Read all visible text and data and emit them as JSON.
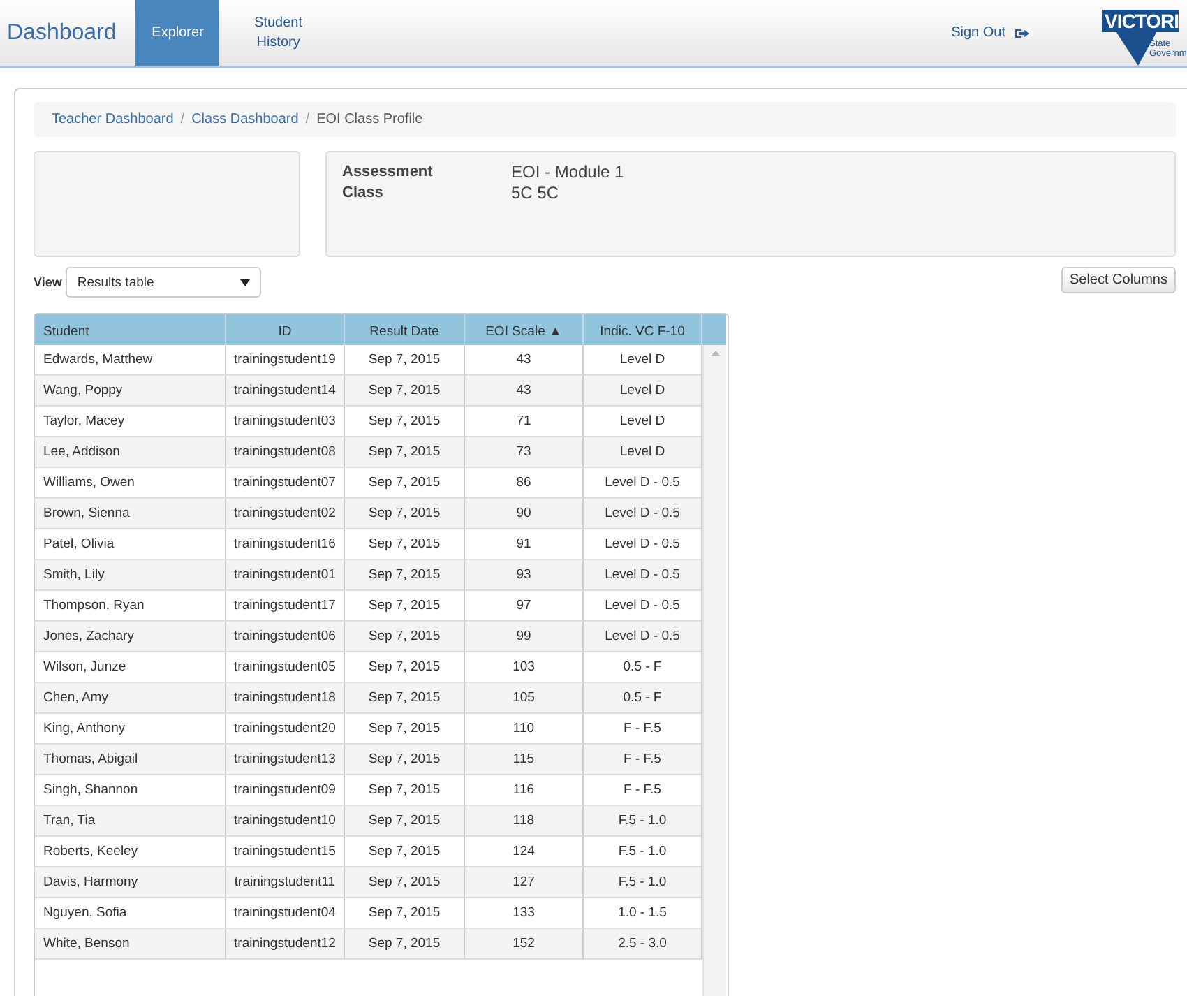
{
  "navbar": {
    "brand": "Dashboard",
    "tabs": [
      {
        "label": "Explorer",
        "selected": true
      },
      {
        "label": "Student History",
        "selected": false
      }
    ],
    "sign_out": "Sign Out",
    "logo": {
      "title": "VICTORI",
      "line_1": "State",
      "line_2": "Governm"
    }
  },
  "breadcrumb": [
    {
      "label": "Teacher Dashboard",
      "link": true
    },
    {
      "separator": "/",
      "label": "Class Dashboard",
      "link": true
    },
    {
      "separator": "/",
      "label": "EOI Class Profile",
      "link": false
    }
  ],
  "info": [
    {
      "label": "Assessment",
      "value": "EOI - Module 1"
    },
    {
      "label": "Class",
      "value": "5C 5C"
    }
  ],
  "view": {
    "label": "View",
    "value": "Results table"
  },
  "select_columns": "Select Columns",
  "table": {
    "columns": [
      "Student",
      "ID",
      "Result Date",
      "EOI Scale ▲",
      "Indic. VC F-10"
    ],
    "rows": [
      [
        "Edwards, Matthew",
        "trainingstudent19",
        "Sep 7, 2015",
        "43",
        "Level D"
      ],
      [
        "Wang, Poppy",
        "trainingstudent14",
        "Sep 7, 2015",
        "43",
        "Level D"
      ],
      [
        "Taylor, Macey",
        "trainingstudent03",
        "Sep 7, 2015",
        "71",
        "Level D"
      ],
      [
        "Lee, Addison",
        "trainingstudent08",
        "Sep 7, 2015",
        "73",
        "Level D"
      ],
      [
        "Williams, Owen",
        "trainingstudent07",
        "Sep 7, 2015",
        "86",
        "Level D - 0.5"
      ],
      [
        "Brown, Sienna",
        "trainingstudent02",
        "Sep 7, 2015",
        "90",
        "Level D - 0.5"
      ],
      [
        "Patel, Olivia",
        "trainingstudent16",
        "Sep 7, 2015",
        "91",
        "Level D - 0.5"
      ],
      [
        "Smith, Lily",
        "trainingstudent01",
        "Sep 7, 2015",
        "93",
        "Level D - 0.5"
      ],
      [
        "Thompson, Ryan",
        "trainingstudent17",
        "Sep 7, 2015",
        "97",
        "Level D - 0.5"
      ],
      [
        "Jones, Zachary",
        "trainingstudent06",
        "Sep 7, 2015",
        "99",
        "Level D - 0.5"
      ],
      [
        "Wilson, Junze",
        "trainingstudent05",
        "Sep 7, 2015",
        "103",
        "0.5 - F"
      ],
      [
        "Chen, Amy",
        "trainingstudent18",
        "Sep 7, 2015",
        "105",
        "0.5 - F"
      ],
      [
        "King, Anthony",
        "trainingstudent20",
        "Sep 7, 2015",
        "110",
        "F - F.5"
      ],
      [
        "Thomas, Abigail",
        "trainingstudent13",
        "Sep 7, 2015",
        "115",
        "F - F.5"
      ],
      [
        "Singh, Shannon",
        "trainingstudent09",
        "Sep 7, 2015",
        "116",
        "F - F.5"
      ],
      [
        "Tran, Tia",
        "trainingstudent10",
        "Sep 7, 2015",
        "118",
        "F.5 - 1.0"
      ],
      [
        "Roberts, Keeley",
        "trainingstudent15",
        "Sep 7, 2015",
        "124",
        "F.5 - 1.0"
      ],
      [
        "Davis, Harmony",
        "trainingstudent11",
        "Sep 7, 2015",
        "127",
        "F.5 - 1.0"
      ],
      [
        "Nguyen, Sofia",
        "trainingstudent04",
        "Sep 7, 2015",
        "133",
        "1.0 - 1.5"
      ],
      [
        "White, Benson",
        "trainingstudent12",
        "Sep 7, 2015",
        "152",
        "2.5 - 3.0"
      ]
    ]
  }
}
